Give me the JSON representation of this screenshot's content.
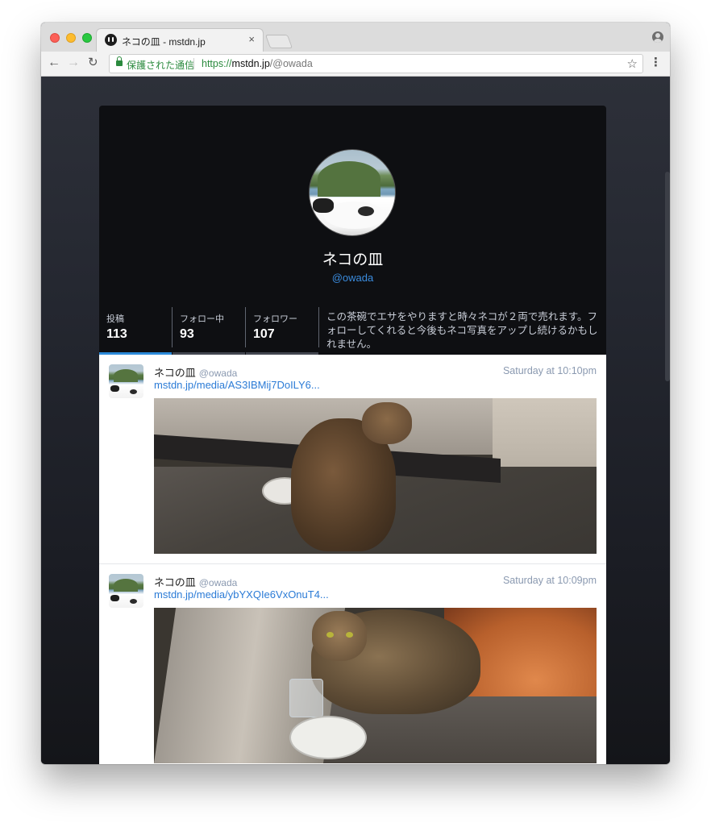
{
  "browser": {
    "tab_title": "ネコの皿 - mstdn.jp",
    "tab_close": "×",
    "secure_label": "保護された通信",
    "url": {
      "scheme": "https://",
      "host": "mstdn.jp",
      "path": "/@owada"
    },
    "icons": {
      "back": "arrow-left-icon",
      "forward": "arrow-right-icon",
      "reload": "reload-icon",
      "lock": "lock-icon",
      "star": "star-icon",
      "menu": "kebab-menu-icon",
      "profile": "user-profile-icon"
    }
  },
  "profile": {
    "display_name": "ネコの皿",
    "acct": "@owada",
    "stats": [
      {
        "label": "投稿",
        "value": "113"
      },
      {
        "label": "フォロー中",
        "value": "93"
      },
      {
        "label": "フォロワー",
        "value": "107"
      }
    ],
    "bio": "この茶碗でエサをやりますと時々ネコが２両で売れます。フォローしてくれると今後もネコ写真をアップし続けるかもしれません。"
  },
  "statuses": [
    {
      "display_name": "ネコの皿",
      "acct": "@owada",
      "time": "Saturday at 10:10pm",
      "link": "mstdn.jp/media/AS3IBMij7DoILY6..."
    },
    {
      "display_name": "ネコの皿",
      "acct": "@owada",
      "time": "Saturday at 10:09pm",
      "link": "mstdn.jp/media/ybYXQIe6VxOnuT4..."
    }
  ],
  "colors": {
    "accent": "#2b8ad9",
    "secure_green": "#2b8a3e",
    "page_bg": "#1b1d24"
  }
}
